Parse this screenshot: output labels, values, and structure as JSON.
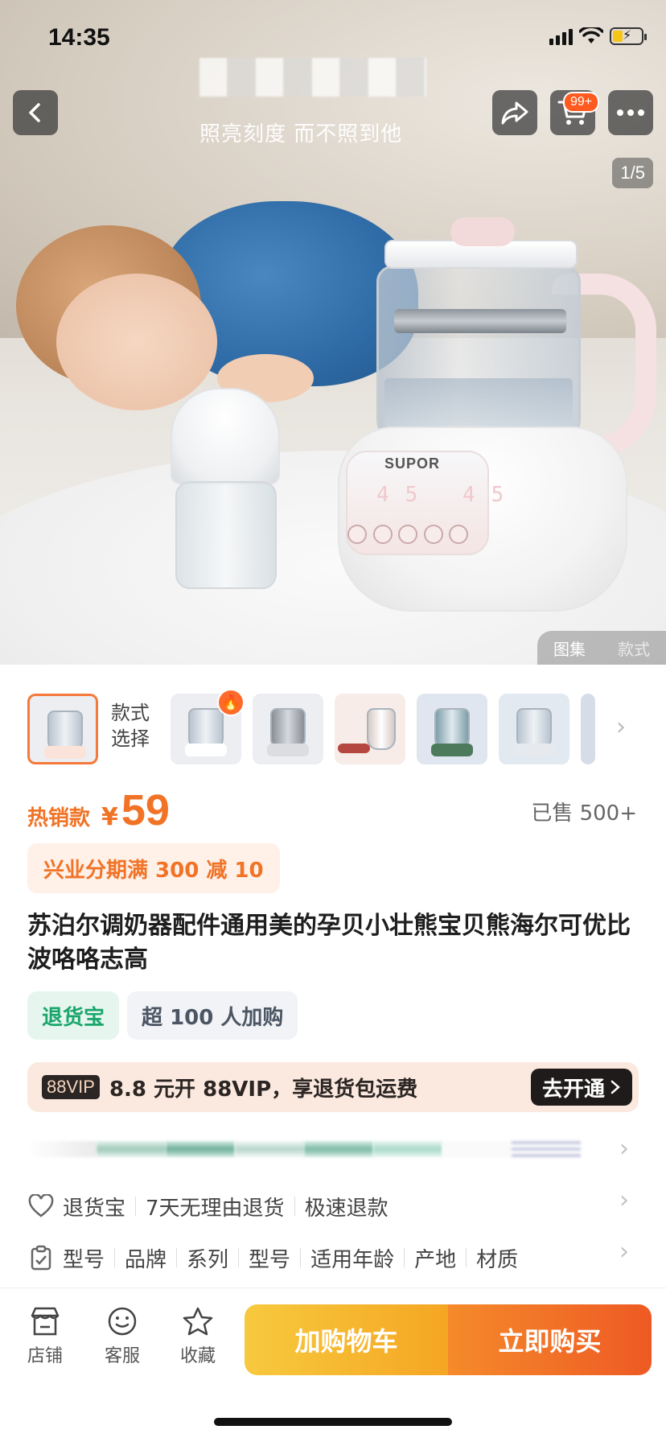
{
  "status_bar": {
    "time": "14:35"
  },
  "header": {
    "subtitle": "照亮刻度 而不照到他",
    "cart_badge": "99+",
    "page_counter": "1/5",
    "view_tabs": [
      "图集",
      "款式"
    ]
  },
  "hero": {
    "brand": "SUPOR",
    "panel_digits": "45 45"
  },
  "styles": {
    "label_line1": "款式",
    "label_line2": "选择",
    "thumb_accents": [
      "#f5793b",
      "#ffffff",
      "#9aa0a6",
      "#b4473f",
      "#4c7a5a",
      "#e6e9ee",
      "#7d8da5"
    ]
  },
  "price": {
    "tag": "热销款",
    "currency": "¥",
    "value": "59",
    "sold": "已售 500+"
  },
  "promo": {
    "text": "兴业分期满 300 减 10"
  },
  "product": {
    "title": "苏泊尔调奶器配件通用美的孕贝小壮熊宝贝熊海尔可优比波咯咯志高"
  },
  "tags": [
    "退货宝",
    "超 100 人加购"
  ],
  "vip": {
    "badge": "88VIP",
    "text": "8.8 元开 88VIP，享退货包运费",
    "button": "去开通"
  },
  "service_row": {
    "items": [
      "退货宝",
      "7天无理由退货",
      "极速退款"
    ]
  },
  "params_row": {
    "items": [
      "型号",
      "品牌",
      "系列",
      "型号",
      "适用年龄",
      "产地",
      "材质"
    ]
  },
  "bottom_bar": {
    "store": "店铺",
    "service": "客服",
    "favorite": "收藏",
    "add_to_cart": "加购物车",
    "buy_now": "立即购买"
  },
  "colors": {
    "accent_orange": "#f07326",
    "green_tag": "#1aa66b",
    "cart_yellow": "#f5a623",
    "buy_orange": "#ee5a24"
  }
}
